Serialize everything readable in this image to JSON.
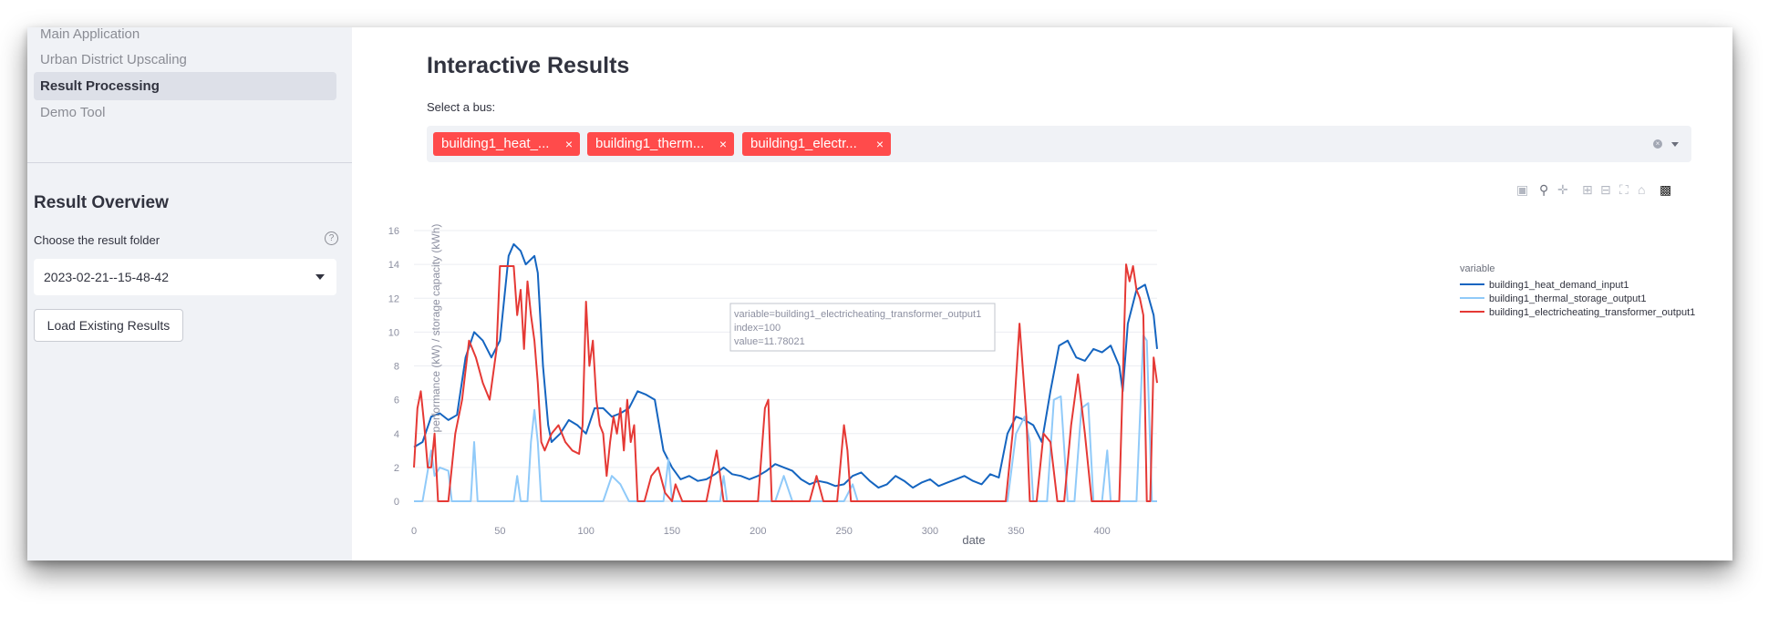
{
  "sidebar": {
    "nav": [
      {
        "label": "Main Application",
        "active": false
      },
      {
        "label": "Urban District Upscaling",
        "active": false
      },
      {
        "label": "Result Processing",
        "active": true
      },
      {
        "label": "Demo Tool",
        "active": false
      }
    ],
    "heading": "Result Overview",
    "folder_label": "Choose the result folder",
    "folder_value": "2023-02-21--15-48-42",
    "load_button": "Load Existing Results"
  },
  "main": {
    "title": "Interactive Results",
    "bus_label": "Select a bus:",
    "tags": [
      "building1_heat_...",
      "building1_therm...",
      "building1_electr..."
    ],
    "tag_remove": "×",
    "modebar_icons": [
      "camera-icon",
      "zoom-icon",
      "pan-icon",
      "zoom-in-icon",
      "zoom-out-icon",
      "autoscale-icon",
      "reset-axes-icon",
      "plotly-logo-icon"
    ]
  },
  "tooltip": {
    "line1": "variable=building1_electricheating_transformer_output1",
    "line2": "index=100",
    "line3": "value=11.78021"
  },
  "chart_data": {
    "type": "line",
    "xlabel": "date",
    "ylabel": "performance (kW) / storage capacity (kWh)",
    "xlim": [
      0,
      432
    ],
    "ylim": [
      0,
      16
    ],
    "x_ticks": [
      0,
      50,
      100,
      150,
      200,
      250,
      300,
      350,
      400
    ],
    "y_ticks": [
      0,
      2,
      4,
      6,
      8,
      10,
      12,
      14,
      16
    ],
    "grid": true,
    "legend_title": "variable",
    "legend_position": "right",
    "series": [
      {
        "name": "building1_heat_demand_input1",
        "color": "#1565c0",
        "points": [
          [
            0,
            3.2
          ],
          [
            5,
            3.5
          ],
          [
            10,
            5.0
          ],
          [
            15,
            5.2
          ],
          [
            20,
            4.8
          ],
          [
            25,
            5.1
          ],
          [
            30,
            8.5
          ],
          [
            35,
            10.0
          ],
          [
            40,
            9.5
          ],
          [
            45,
            8.5
          ],
          [
            50,
            9.5
          ],
          [
            55,
            14.5
          ],
          [
            58,
            15.2
          ],
          [
            62,
            14.8
          ],
          [
            65,
            14.0
          ],
          [
            70,
            14.5
          ],
          [
            72,
            13.5
          ],
          [
            75,
            8.0
          ],
          [
            78,
            4.5
          ],
          [
            80,
            3.5
          ],
          [
            85,
            4.0
          ],
          [
            90,
            4.8
          ],
          [
            95,
            4.5
          ],
          [
            100,
            4.0
          ],
          [
            105,
            5.5
          ],
          [
            110,
            5.5
          ],
          [
            115,
            5.0
          ],
          [
            120,
            5.2
          ],
          [
            125,
            5.5
          ],
          [
            130,
            6.5
          ],
          [
            135,
            6.3
          ],
          [
            140,
            6.0
          ],
          [
            145,
            3.0
          ],
          [
            150,
            2.0
          ],
          [
            155,
            1.3
          ],
          [
            160,
            1.5
          ],
          [
            165,
            1.2
          ],
          [
            170,
            1.3
          ],
          [
            175,
            1.6
          ],
          [
            180,
            2.0
          ],
          [
            185,
            1.6
          ],
          [
            190,
            1.5
          ],
          [
            195,
            1.3
          ],
          [
            200,
            1.5
          ],
          [
            205,
            1.8
          ],
          [
            210,
            2.2
          ],
          [
            215,
            2.0
          ],
          [
            220,
            1.8
          ],
          [
            225,
            1.3
          ],
          [
            230,
            1.0
          ],
          [
            235,
            1.2
          ],
          [
            240,
            1.1
          ],
          [
            245,
            0.9
          ],
          [
            250,
            1.0
          ],
          [
            255,
            1.5
          ],
          [
            260,
            1.7
          ],
          [
            265,
            1.2
          ],
          [
            270,
            0.8
          ],
          [
            275,
            1.0
          ],
          [
            280,
            1.5
          ],
          [
            285,
            1.2
          ],
          [
            290,
            0.8
          ],
          [
            295,
            1.1
          ],
          [
            300,
            1.3
          ],
          [
            305,
            0.9
          ],
          [
            310,
            1.1
          ],
          [
            315,
            1.3
          ],
          [
            320,
            1.5
          ],
          [
            325,
            1.2
          ],
          [
            330,
            1.0
          ],
          [
            335,
            1.6
          ],
          [
            340,
            1.4
          ],
          [
            345,
            4.0
          ],
          [
            350,
            5.0
          ],
          [
            355,
            4.8
          ],
          [
            360,
            4.5
          ],
          [
            365,
            3.5
          ],
          [
            370,
            6.5
          ],
          [
            375,
            9.2
          ],
          [
            380,
            9.5
          ],
          [
            385,
            8.5
          ],
          [
            390,
            8.3
          ],
          [
            395,
            9.0
          ],
          [
            400,
            8.8
          ],
          [
            405,
            9.2
          ],
          [
            410,
            8.0
          ],
          [
            412,
            6.5
          ],
          [
            415,
            10.5
          ],
          [
            420,
            12.5
          ],
          [
            425,
            12.8
          ],
          [
            430,
            11.0
          ],
          [
            432,
            9.0
          ]
        ]
      },
      {
        "name": "building1_thermal_storage_output1",
        "color": "#90caf9",
        "points": [
          [
            0,
            0
          ],
          [
            5,
            0
          ],
          [
            10,
            3.0
          ],
          [
            12,
            1.5
          ],
          [
            15,
            2.0
          ],
          [
            20,
            1.8
          ],
          [
            22,
            0
          ],
          [
            33,
            0
          ],
          [
            35,
            3.5
          ],
          [
            37,
            0
          ],
          [
            58,
            0
          ],
          [
            60,
            1.5
          ],
          [
            62,
            0
          ],
          [
            66,
            0
          ],
          [
            68,
            3.5
          ],
          [
            70,
            5.4
          ],
          [
            72,
            3.5
          ],
          [
            74,
            0
          ],
          [
            110,
            0
          ],
          [
            115,
            1.5
          ],
          [
            120,
            1.0
          ],
          [
            125,
            0
          ],
          [
            145,
            0
          ],
          [
            148,
            2.5
          ],
          [
            150,
            0
          ],
          [
            178,
            0
          ],
          [
            180,
            1.5
          ],
          [
            182,
            0
          ],
          [
            210,
            0
          ],
          [
            215,
            1.5
          ],
          [
            220,
            0
          ],
          [
            250,
            0
          ],
          [
            255,
            1.0
          ],
          [
            258,
            0
          ],
          [
            345,
            0
          ],
          [
            350,
            4.0
          ],
          [
            355,
            5.0
          ],
          [
            358,
            3.5
          ],
          [
            360,
            0
          ],
          [
            368,
            0
          ],
          [
            372,
            6.0
          ],
          [
            376,
            6.2
          ],
          [
            380,
            0
          ],
          [
            384,
            0
          ],
          [
            388,
            5.5
          ],
          [
            392,
            5.8
          ],
          [
            395,
            0
          ],
          [
            400,
            0
          ],
          [
            403,
            3.0
          ],
          [
            405,
            0
          ],
          [
            420,
            0
          ],
          [
            424,
            9.8
          ],
          [
            426,
            9.5
          ],
          [
            429,
            0
          ],
          [
            432,
            0
          ]
        ]
      },
      {
        "name": "building1_electricheating_transformer_output1",
        "color": "#e53935",
        "points": [
          [
            0,
            2.0
          ],
          [
            2,
            5.5
          ],
          [
            4,
            6.5
          ],
          [
            6,
            4.5
          ],
          [
            8,
            2.0
          ],
          [
            10,
            2.0
          ],
          [
            12,
            4.0
          ],
          [
            14,
            0
          ],
          [
            20,
            0
          ],
          [
            24,
            4.0
          ],
          [
            28,
            6.0
          ],
          [
            32,
            9.5
          ],
          [
            36,
            8.5
          ],
          [
            40,
            7.0
          ],
          [
            44,
            6.0
          ],
          [
            48,
            9.0
          ],
          [
            50,
            13.9
          ],
          [
            54,
            13.9
          ],
          [
            58,
            13.9
          ],
          [
            60,
            11.0
          ],
          [
            62,
            12.5
          ],
          [
            64,
            9.0
          ],
          [
            66,
            13.0
          ],
          [
            68,
            11.0
          ],
          [
            70,
            9.5
          ],
          [
            72,
            7.0
          ],
          [
            74,
            3.5
          ],
          [
            76,
            3.0
          ],
          [
            80,
            4.0
          ],
          [
            84,
            4.5
          ],
          [
            88,
            3.5
          ],
          [
            92,
            3.0
          ],
          [
            96,
            2.8
          ],
          [
            98,
            4.5
          ],
          [
            100,
            11.8
          ],
          [
            102,
            8.0
          ],
          [
            104,
            9.5
          ],
          [
            106,
            6.0
          ],
          [
            108,
            4.5
          ],
          [
            110,
            4.0
          ],
          [
            112,
            1.5
          ],
          [
            114,
            3.5
          ],
          [
            116,
            5.0
          ],
          [
            118,
            4.0
          ],
          [
            120,
            5.5
          ],
          [
            122,
            3.0
          ],
          [
            124,
            6.0
          ],
          [
            126,
            3.5
          ],
          [
            128,
            4.5
          ],
          [
            130,
            0
          ],
          [
            134,
            0
          ],
          [
            138,
            1.5
          ],
          [
            142,
            2.0
          ],
          [
            146,
            0.5
          ],
          [
            150,
            0
          ],
          [
            152,
            1.0
          ],
          [
            156,
            0
          ],
          [
            170,
            0
          ],
          [
            176,
            3.0
          ],
          [
            180,
            0
          ],
          [
            200,
            0
          ],
          [
            204,
            5.5
          ],
          [
            206,
            6.0
          ],
          [
            208,
            0
          ],
          [
            210,
            0
          ],
          [
            230,
            0
          ],
          [
            234,
            1.5
          ],
          [
            238,
            0
          ],
          [
            246,
            0
          ],
          [
            250,
            4.5
          ],
          [
            252,
            3.0
          ],
          [
            254,
            0
          ],
          [
            338,
            0
          ],
          [
            344,
            0
          ],
          [
            348,
            4.0
          ],
          [
            352,
            10.5
          ],
          [
            356,
            5.0
          ],
          [
            358,
            0
          ],
          [
            362,
            0
          ],
          [
            366,
            4.0
          ],
          [
            370,
            3.5
          ],
          [
            374,
            0
          ],
          [
            378,
            0
          ],
          [
            382,
            4.5
          ],
          [
            386,
            7.5
          ],
          [
            390,
            4.0
          ],
          [
            394,
            0
          ],
          [
            410,
            0
          ],
          [
            414,
            14.0
          ],
          [
            416,
            13.0
          ],
          [
            418,
            13.9
          ],
          [
            420,
            12.5
          ],
          [
            422,
            12.0
          ],
          [
            424,
            11.0
          ],
          [
            426,
            0
          ],
          [
            428,
            0
          ],
          [
            430,
            8.5
          ],
          [
            432,
            7.0
          ]
        ]
      }
    ]
  }
}
